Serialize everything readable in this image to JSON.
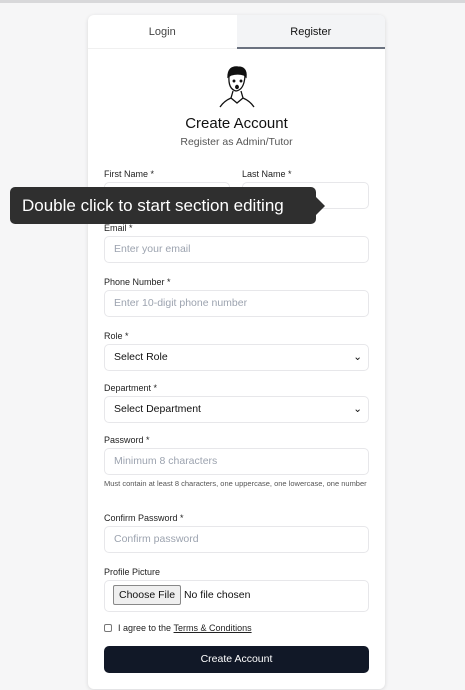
{
  "tabs": {
    "login": "Login",
    "register": "Register"
  },
  "header": {
    "title": "Create Account",
    "subtitle": "Register as Admin/Tutor"
  },
  "fields": {
    "first_name": {
      "label": "First Name *",
      "placeholder": ""
    },
    "last_name": {
      "label": "Last Name *",
      "placeholder": ""
    },
    "email": {
      "label": "Email *",
      "placeholder": "Enter your email"
    },
    "phone": {
      "label": "Phone Number *",
      "placeholder": "Enter 10-digit phone number"
    },
    "role": {
      "label": "Role *",
      "value": "Select Role"
    },
    "department": {
      "label": "Department *",
      "value": "Select Department"
    },
    "password": {
      "label": "Password *",
      "placeholder": "Minimum 8 characters",
      "hint": "Must contain at least 8 characters, one uppercase, one lowercase, one number"
    },
    "confirm": {
      "label": "Confirm Password *",
      "placeholder": "Confirm password"
    },
    "picture": {
      "label": "Profile Picture",
      "button": "Choose File",
      "status": "No file chosen"
    }
  },
  "terms": {
    "text": "I agree to the ",
    "link": "Terms & Conditions"
  },
  "submit": "Create Account",
  "tooltip": "Double click to start section editing"
}
